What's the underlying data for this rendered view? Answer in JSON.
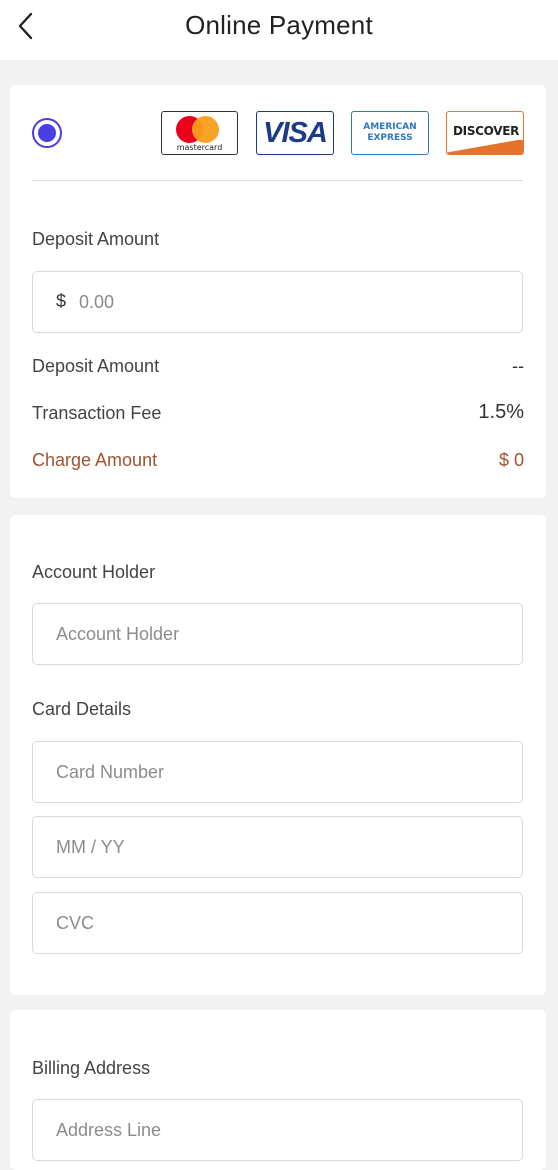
{
  "header": {
    "title": "Online Payment"
  },
  "payment_methods": {
    "selected": true,
    "brands": [
      {
        "name": "mastercard",
        "label": "mastercard"
      },
      {
        "name": "visa",
        "label": "VISA"
      },
      {
        "name": "amex",
        "label_line1": "AMERICAN",
        "label_line2": "EXPRESS"
      },
      {
        "name": "discover",
        "label": "DISCOVER"
      }
    ]
  },
  "deposit": {
    "label": "Deposit Amount",
    "currency_symbol": "$",
    "placeholder": "0.00",
    "summary": {
      "deposit_label": "Deposit Amount",
      "deposit_value": "--",
      "fee_label": "Transaction Fee",
      "fee_value": "1.5%",
      "charge_label": "Charge Amount",
      "charge_value": "$ 0"
    }
  },
  "account": {
    "holder_label": "Account Holder",
    "holder_placeholder": "Account Holder",
    "card_details_label": "Card Details",
    "card_number_placeholder": "Card Number",
    "expiry_placeholder": "MM / YY",
    "cvc_placeholder": "CVC"
  },
  "billing": {
    "label": "Billing Address",
    "address_placeholder": "Address Line"
  },
  "colors": {
    "accent": "#4a3ee6",
    "charge": "#a0522d",
    "background": "#f2f2f2"
  }
}
